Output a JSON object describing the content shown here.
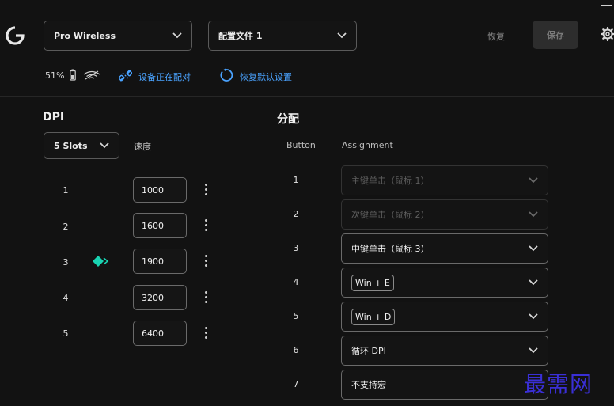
{
  "header": {
    "device_select": "Pro Wireless",
    "profile_select": "配置文件 1",
    "restore_label": "恢复",
    "save_label": "保存"
  },
  "status": {
    "battery": "51%",
    "pairing_text": "设备正在配对",
    "reset_defaults": "恢复默认设置"
  },
  "dpi": {
    "title": "DPI",
    "slots_select": "5 Slots",
    "speed_label": "速度",
    "rows": [
      {
        "num": "1",
        "value": "1000",
        "active": false
      },
      {
        "num": "2",
        "value": "1600",
        "active": false
      },
      {
        "num": "3",
        "value": "1900",
        "active": true
      },
      {
        "num": "4",
        "value": "3200",
        "active": false
      },
      {
        "num": "5",
        "value": "6400",
        "active": false
      }
    ]
  },
  "assignment": {
    "title": "分配",
    "col_button": "Button",
    "col_assignment": "Assignment",
    "rows": [
      {
        "num": "1",
        "label": "主键单击（鼠标 1）"
      },
      {
        "num": "2",
        "label": "次键单击（鼠标 2）"
      },
      {
        "num": "3",
        "label": "中键单击（鼠标 3）"
      },
      {
        "num": "4",
        "label": "Win + E"
      },
      {
        "num": "5",
        "label": "Win + D"
      },
      {
        "num": "6",
        "label": "循环 DPI"
      },
      {
        "num": "7",
        "label": "不支持宏"
      }
    ]
  },
  "watermark": "最需网",
  "colors": {
    "accent_blue": "#4aa3ff",
    "active_dpi": "#19d3b2",
    "watermark": "#3a2fd6"
  }
}
